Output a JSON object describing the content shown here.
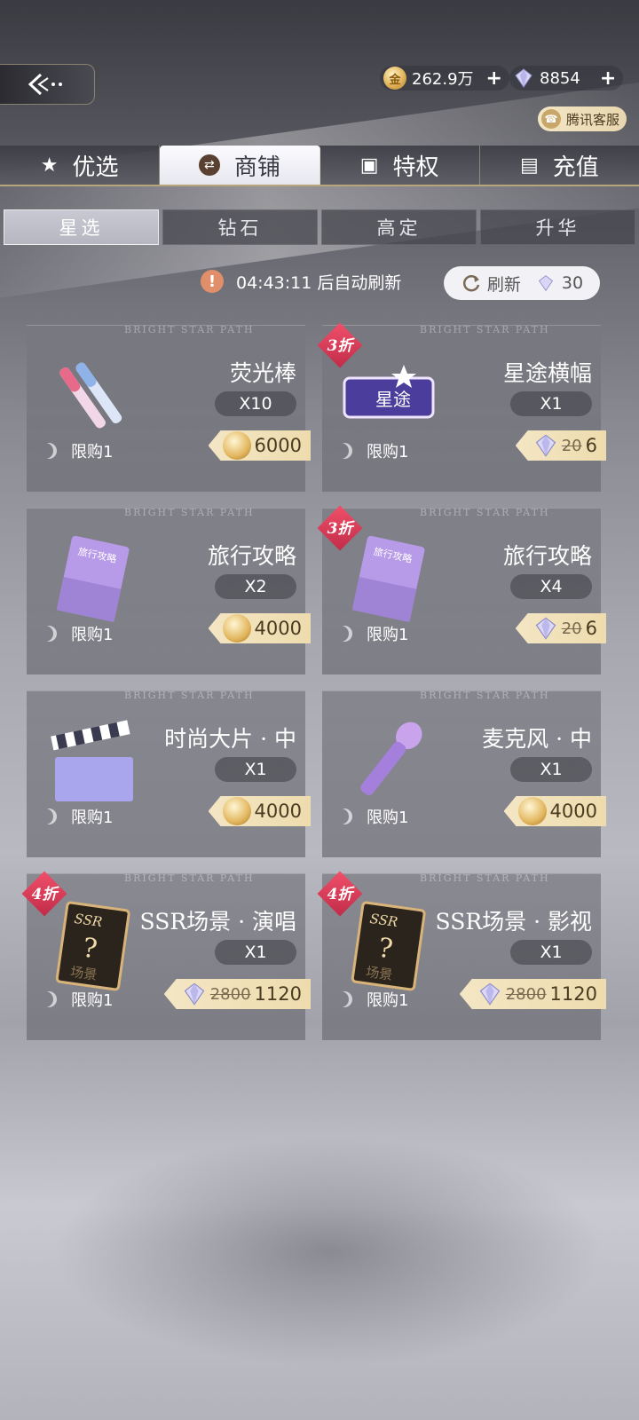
{
  "currencies": [
    {
      "icon": "gold-coin-icon",
      "value": "262.9万"
    },
    {
      "icon": "diamond-gem-icon",
      "value": "8854"
    }
  ],
  "service": {
    "label": "腾讯客服"
  },
  "tabs": [
    {
      "label": "优选",
      "icon": "star-icon",
      "active": false
    },
    {
      "label": "商铺",
      "icon": "exchange-icon",
      "active": true
    },
    {
      "label": "特权",
      "icon": "vip-card-icon",
      "active": false
    },
    {
      "label": "充值",
      "icon": "recharge-icon",
      "active": false
    }
  ],
  "subtabs": [
    {
      "label": "星选",
      "active": true
    },
    {
      "label": "钻石",
      "active": false
    },
    {
      "label": "高定",
      "active": false
    },
    {
      "label": "升华",
      "active": false
    }
  ],
  "refresh": {
    "timer_text": "04:43:11 后自动刷新",
    "button_label": "刷新",
    "cost": "30"
  },
  "watermark": "BRIGHT STAR PATH",
  "items": [
    {
      "name": "荧光棒",
      "qty": "X10",
      "limit": "限购1",
      "currency": "coin",
      "price": "6000",
      "old_price": "",
      "badge": ""
    },
    {
      "name": "星途横幅",
      "qty": "X1",
      "limit": "限购1",
      "currency": "gem",
      "price": "6",
      "old_price": "20",
      "badge": "3折"
    },
    {
      "name": "旅行攻略",
      "qty": "X2",
      "limit": "限购1",
      "currency": "coin",
      "price": "4000",
      "old_price": "",
      "badge": ""
    },
    {
      "name": "旅行攻略",
      "qty": "X4",
      "limit": "限购1",
      "currency": "gem",
      "price": "6",
      "old_price": "20",
      "badge": "3折"
    },
    {
      "name": "时尚大片 · 中",
      "qty": "X1",
      "limit": "限购1",
      "currency": "coin",
      "price": "4000",
      "old_price": "",
      "badge": ""
    },
    {
      "name": "麦克风 · 中",
      "qty": "X1",
      "limit": "限购1",
      "currency": "coin",
      "price": "4000",
      "old_price": "",
      "badge": ""
    },
    {
      "name": "SSR场景 · 演唱",
      "qty": "X1",
      "limit": "限购1",
      "currency": "gem",
      "price": "1120",
      "old_price": "2800",
      "badge": "4折"
    },
    {
      "name": "SSR场景 · 影视",
      "qty": "X1",
      "limit": "限购1",
      "currency": "gem",
      "price": "1120",
      "old_price": "2800",
      "badge": "4折"
    }
  ],
  "item_art": {
    "banner_text": "星途",
    "guide_text": "旅行攻略",
    "ssr_text": "SSR",
    "scene_text": "场景"
  }
}
